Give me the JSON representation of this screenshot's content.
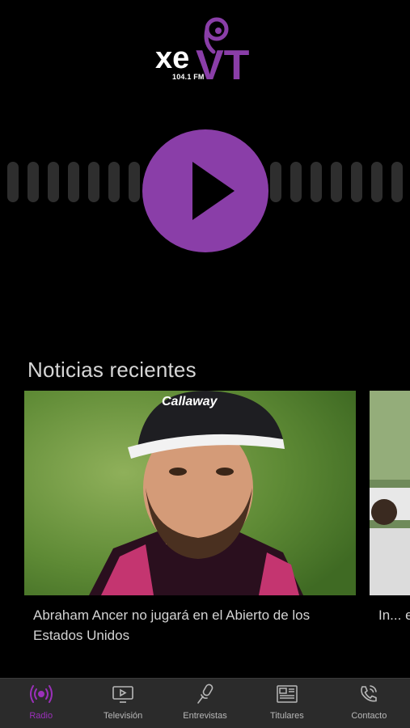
{
  "logo": {
    "brand": "xeVT",
    "frequency": "104.1 FM"
  },
  "player": {
    "state": "paused"
  },
  "news": {
    "section_title": "Noticias recientes",
    "items": [
      {
        "title": "Abraham Ancer no jugará en el Abierto de los Estados Unidos"
      },
      {
        "title": "In... en..."
      }
    ]
  },
  "tabbar": {
    "active_color": "#9b30ba",
    "tabs": [
      {
        "label": "Radio",
        "icon": "radio-broadcast-icon",
        "active": true
      },
      {
        "label": "Televisión",
        "icon": "tv-play-icon",
        "active": false
      },
      {
        "label": "Entrevistas",
        "icon": "microphone-icon",
        "active": false
      },
      {
        "label": "Titulares",
        "icon": "newspaper-icon",
        "active": false
      },
      {
        "label": "Contacto",
        "icon": "phone-icon",
        "active": false
      }
    ]
  },
  "colors": {
    "accent": "#8a3ea8",
    "background": "#000000",
    "tabbar": "#2b2b2b"
  }
}
